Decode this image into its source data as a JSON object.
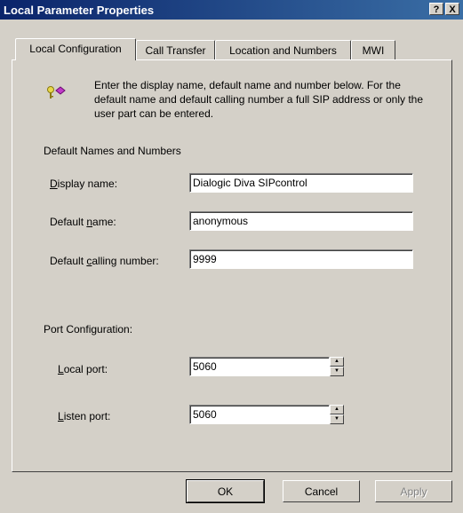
{
  "window": {
    "title": "Local Parameter Properties",
    "help_btn": "?",
    "close_btn": "X"
  },
  "tabs": [
    {
      "label": "Local Configuration",
      "active": true
    },
    {
      "label": "Call Transfer",
      "active": false
    },
    {
      "label": "Location and Numbers",
      "active": false
    },
    {
      "label": "MWI",
      "active": false
    }
  ],
  "intro": {
    "icon": "keys-icon",
    "text": "Enter the display name, default name and number below. For the default name and default calling number a full SIP address or only the user part can be entered."
  },
  "names_group": {
    "legend": "Default Names and Numbers",
    "display_name": {
      "label": "Display name:",
      "value": "Dialogic Diva SIPcontrol"
    },
    "default_name": {
      "label": "Default name:",
      "value": "anonymous"
    },
    "default_calling_number": {
      "label": "Default calling number:",
      "value": "9999"
    }
  },
  "port_group": {
    "legend": "Port Configuration:",
    "local_port": {
      "label": "Local port:",
      "value": "5060"
    },
    "listen_port": {
      "label": "Listen port:",
      "value": "5060"
    }
  },
  "buttons": {
    "ok": "OK",
    "cancel": "Cancel",
    "apply": "Apply"
  }
}
